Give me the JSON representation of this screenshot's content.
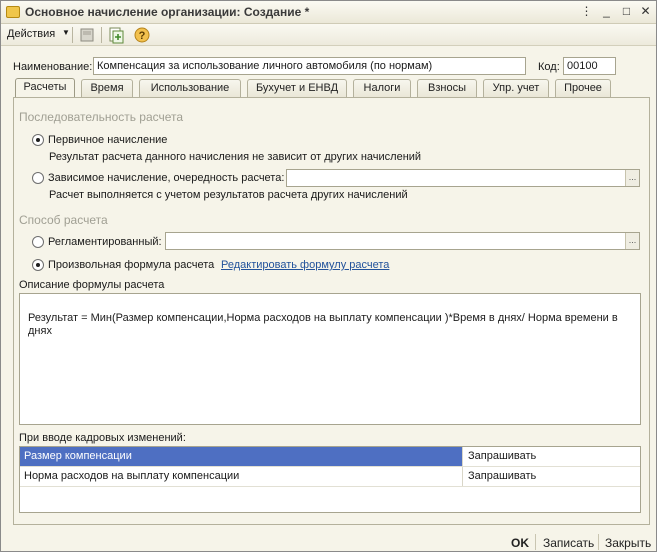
{
  "window": {
    "title": "Основное начисление организации: Создание *",
    "controls": [
      "⋮",
      "_",
      "□",
      "✕"
    ]
  },
  "toolbar": {
    "actions_label": "Действия",
    "icons": [
      "save-to-list-icon",
      "copy-document-icon",
      "help-icon"
    ]
  },
  "header": {
    "name_label": "Наименование:",
    "name_value": "Компенсация за использование личного автомобиля (по нормам)",
    "code_label": "Код:",
    "code_value": "00100"
  },
  "tabs": [
    {
      "label": "Расчеты",
      "active": true
    },
    {
      "label": "Время"
    },
    {
      "label": "Использование"
    },
    {
      "label": "Бухучет и ЕНВД"
    },
    {
      "label": "Налоги"
    },
    {
      "label": "Взносы"
    },
    {
      "label": "Упр. учет"
    },
    {
      "label": "Прочее"
    }
  ],
  "calc_sequence": {
    "title": "Последовательность расчета",
    "primary_label": "Первичное начисление",
    "primary_desc": "Результат расчета данного начисления не зависит от других начислений",
    "dependent_label": "Зависимое начисление, очередность расчета:",
    "dependent_desc": "Расчет выполняется с учетом результатов расчета других начислений",
    "selected": "primary"
  },
  "calc_method": {
    "title": "Способ расчета",
    "regulated_label": "Регламентированный:",
    "custom_label": "Произвольная формула расчета",
    "edit_link": "Редактировать формулу расчета",
    "selected": "custom"
  },
  "formula": {
    "label": "Описание формулы расчета",
    "text": "Результат = Мин(Размер компенсации,Норма расходов на выплату компенсации )*Время в днях/ Норма времени в днях"
  },
  "hr_changes": {
    "label": "При вводе кадровых изменений:",
    "rows": [
      {
        "name": "Размер компенсации",
        "value": "Запрашивать",
        "selected": true
      },
      {
        "name": "Норма расходов на выплату компенсации",
        "value": "Запрашивать",
        "selected": false
      }
    ]
  },
  "footer": {
    "ok": "OK",
    "save": "Записать",
    "close": "Закрыть"
  },
  "colors": {
    "background": "#f6f4e9",
    "selection": "#4e6fc2",
    "link": "#22529b"
  }
}
